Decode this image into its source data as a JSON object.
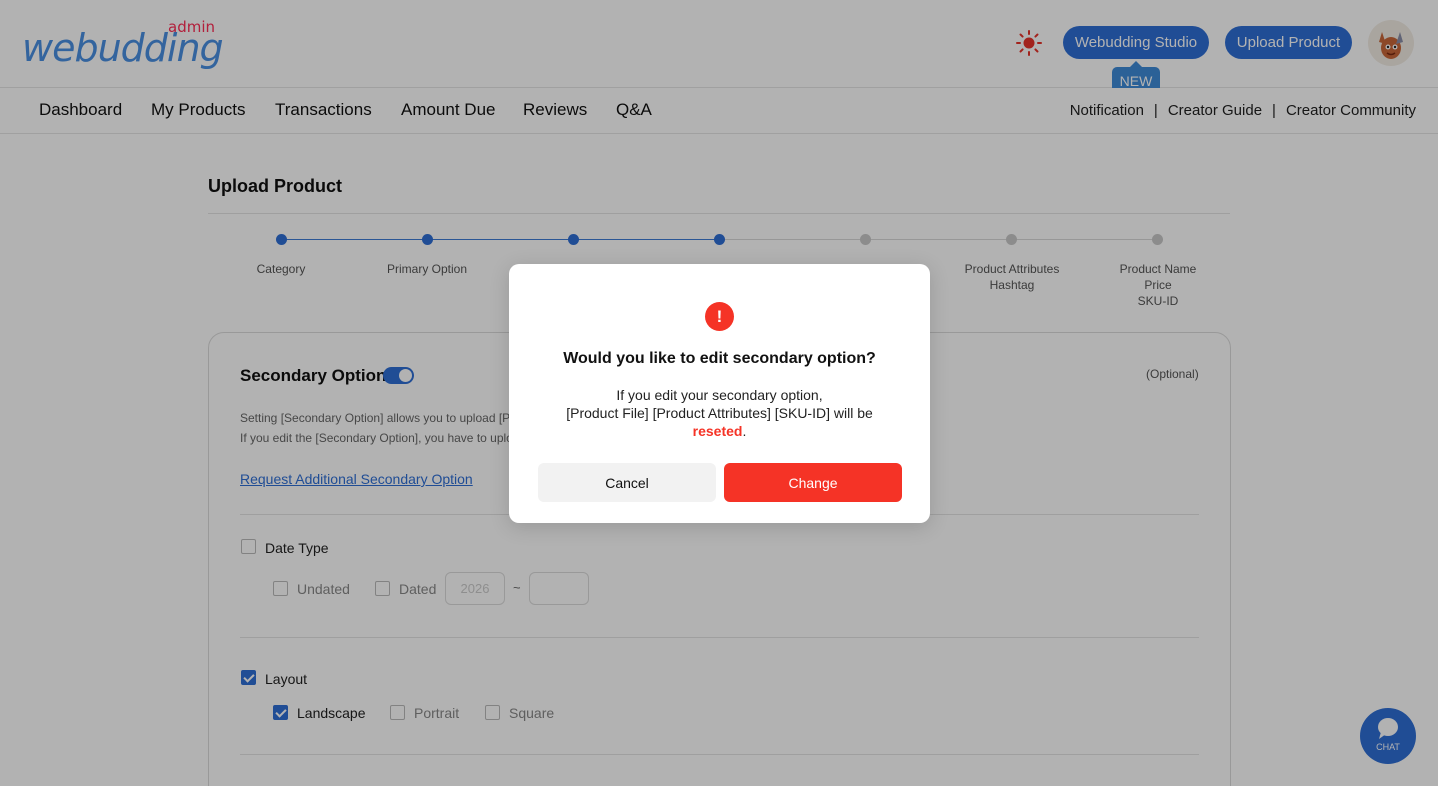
{
  "header": {
    "logo_text": "webudding",
    "logo_sub": "admin",
    "studio_button": "Webudding Studio",
    "upload_button": "Upload Product",
    "new_badge": "NEW"
  },
  "nav": {
    "items": [
      "Dashboard",
      "My Products",
      "Transactions",
      "Amount Due",
      "Reviews",
      "Q&A"
    ],
    "right_links": [
      "Notification",
      "Creator Guide",
      "Creator Community"
    ],
    "separator": "|"
  },
  "page": {
    "title": "Upload Product",
    "steps": [
      {
        "label": "Category",
        "done": true
      },
      {
        "label": "Primary Option",
        "done": true
      },
      {
        "label": "",
        "done": true
      },
      {
        "label": "",
        "done": true
      },
      {
        "label": "",
        "done": false
      },
      {
        "label": "Product Attributes\nHashtag",
        "done": false
      },
      {
        "label": "Product Name\nPrice\nSKU-ID",
        "done": false
      }
    ]
  },
  "secondary": {
    "title": "Secondary Option",
    "optional": "(Optional)",
    "desc1": "Setting [Secondary Option] allows you to upload [P",
    "desc2": "If you edit the [Secondary Option], you have to uplo",
    "request_link": "Request Additional Secondary Option",
    "date_type": {
      "label": "Date Type",
      "undated": "Undated",
      "dated": "Dated",
      "year_placeholder": "2026",
      "tilde": "~"
    },
    "layout": {
      "label": "Layout",
      "landscape": "Landscape",
      "portrait": "Portrait",
      "square": "Square"
    }
  },
  "chat": {
    "label": "CHAT"
  },
  "modal": {
    "icon": "!",
    "title": "Would you like to edit secondary option?",
    "line1": "If you edit your secondary option,",
    "line2": "[Product File] [Product Attributes] [SKU-ID] will be",
    "line3_red": "reseted",
    "line3_end": ".",
    "cancel": "Cancel",
    "change": "Change"
  },
  "colors": {
    "primary": "#2f6fd6",
    "danger": "#f53326",
    "overlay": "rgba(0,0,0,0.30)"
  }
}
